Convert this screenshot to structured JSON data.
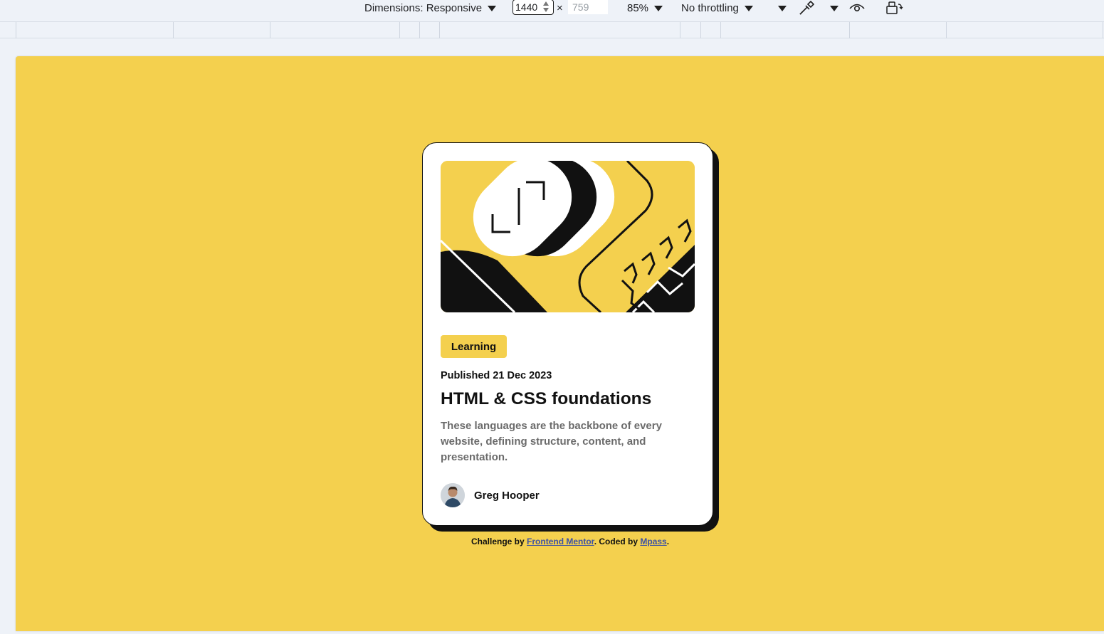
{
  "devtools": {
    "dimensions_label": "Dimensions: Responsive",
    "width_value": "1440",
    "times": "×",
    "height_placeholder": "759",
    "zoom_label": "85%",
    "throttle_label": "No throttling"
  },
  "page": {
    "background_color": "#f4d04e",
    "card": {
      "tag": "Learning",
      "published": "Published 21 Dec 2023",
      "title": "HTML & CSS foundations",
      "description": "These languages are the backbone of every website, defining structure, content, and presentation.",
      "author": "Greg Hooper"
    },
    "footer": {
      "prefix": "Challenge by ",
      "link1": "Frontend Mentor",
      "middle": ". Coded by ",
      "link2": "Mpass",
      "suffix": "."
    }
  }
}
